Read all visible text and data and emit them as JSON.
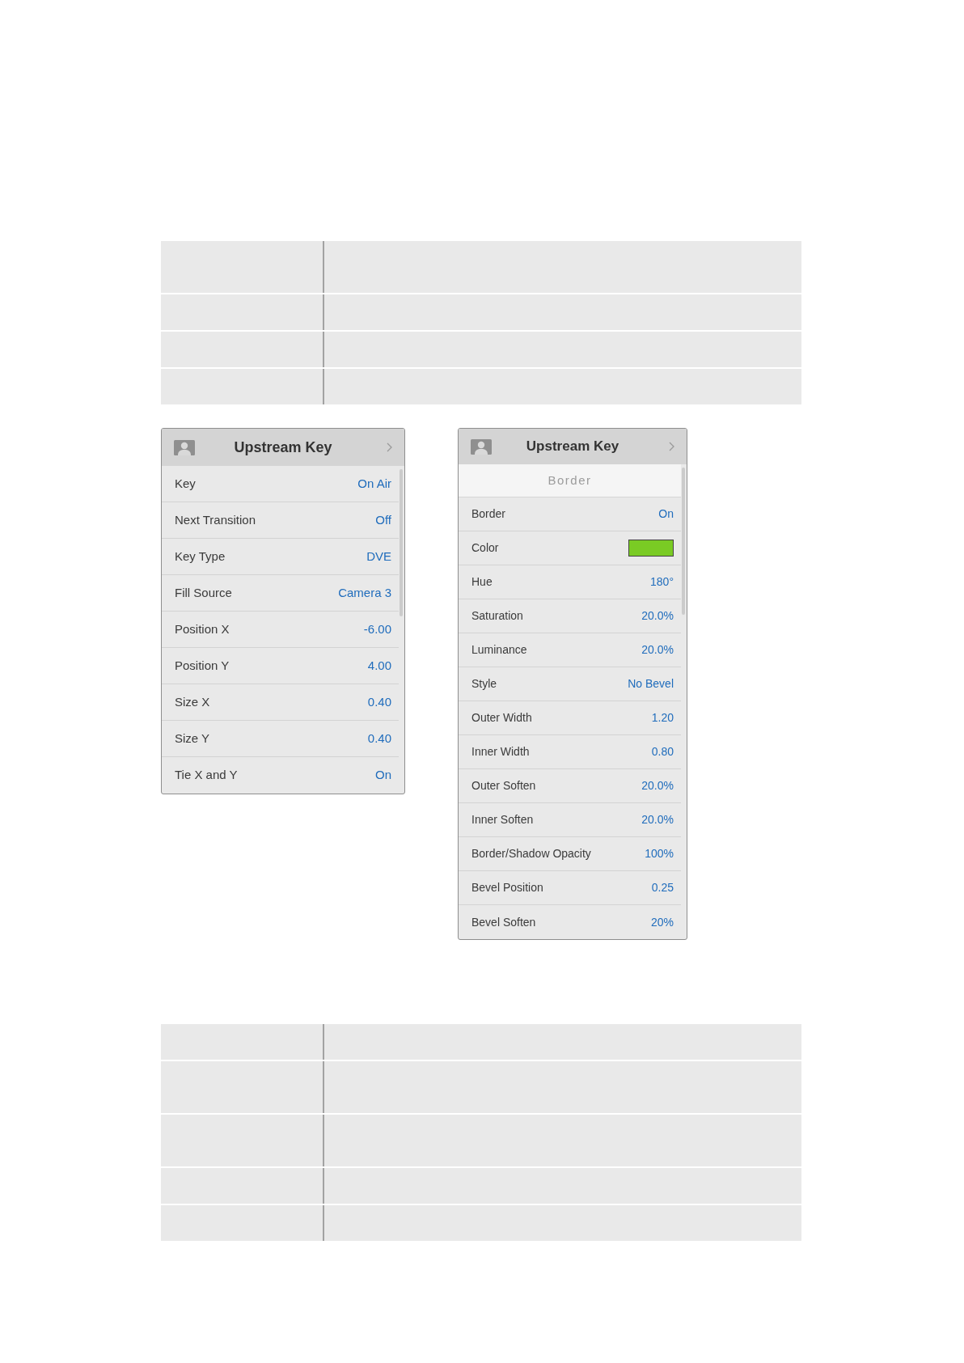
{
  "top_table": {
    "rows": [
      {
        "kind": "tall"
      },
      {
        "kind": "short"
      },
      {
        "kind": "short"
      },
      {
        "kind": "short"
      }
    ]
  },
  "panels": [
    {
      "title": "Upstream Key",
      "rows": [
        {
          "kind": "text",
          "label": "Key",
          "value": "On Air"
        },
        {
          "kind": "text",
          "label": "Next Transition",
          "value": "Off"
        },
        {
          "kind": "text",
          "label": "Key Type",
          "value": "DVE"
        },
        {
          "kind": "text",
          "label": "Fill Source",
          "value": "Camera 3"
        },
        {
          "kind": "text",
          "label": "Position X",
          "value": "-6.00"
        },
        {
          "kind": "text",
          "label": "Position Y",
          "value": "4.00"
        },
        {
          "kind": "text",
          "label": "Size X",
          "value": "0.40"
        },
        {
          "kind": "text",
          "label": "Size Y",
          "value": "0.40"
        },
        {
          "kind": "text",
          "label": "Tie X and Y",
          "value": "On"
        }
      ]
    },
    {
      "title": "Upstream Key",
      "section": "Border",
      "rows": [
        {
          "kind": "text",
          "label": "Border",
          "value": "On"
        },
        {
          "kind": "swatch",
          "label": "Color",
          "color": "#7acb24"
        },
        {
          "kind": "text",
          "label": "Hue",
          "value": "180°"
        },
        {
          "kind": "text",
          "label": "Saturation",
          "value": "20.0%"
        },
        {
          "kind": "text",
          "label": "Luminance",
          "value": "20.0%"
        },
        {
          "kind": "text",
          "label": "Style",
          "value": "No Bevel"
        },
        {
          "kind": "text",
          "label": "Outer Width",
          "value": "1.20"
        },
        {
          "kind": "text",
          "label": "Inner Width",
          "value": "0.80"
        },
        {
          "kind": "text",
          "label": "Outer Soften",
          "value": "20.0%"
        },
        {
          "kind": "text",
          "label": "Inner Soften",
          "value": "20.0%"
        },
        {
          "kind": "text",
          "label": "Border/Shadow Opacity",
          "value": "100%"
        },
        {
          "kind": "text",
          "label": "Bevel Position",
          "value": "0.25"
        },
        {
          "kind": "text",
          "label": "Bevel Soften",
          "value": "20%"
        }
      ]
    }
  ],
  "bottom_table": {
    "rows": [
      {
        "kind": "short"
      },
      {
        "kind": "tall"
      },
      {
        "kind": "tall"
      },
      {
        "kind": "short"
      },
      {
        "kind": "short"
      }
    ]
  }
}
